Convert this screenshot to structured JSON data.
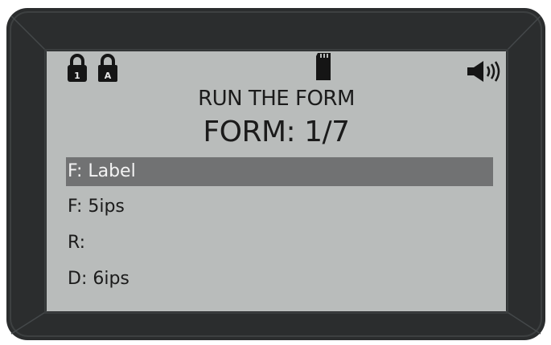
{
  "screen": {
    "title": "RUN THE FORM",
    "subtitle": "FORM: 1/7",
    "icons": {
      "lock_numeric": "lock-icon",
      "lock_numeric_badge": "1",
      "lock_alpha": "lock-icon",
      "lock_alpha_badge": "A",
      "storage": "sd-card-icon",
      "sound": "speaker-icon"
    },
    "items": [
      {
        "label": "F: Label",
        "selected": true
      },
      {
        "label": "F: 5ips",
        "selected": false
      },
      {
        "label": "R:",
        "selected": false
      },
      {
        "label": "D: 6ips",
        "selected": false
      }
    ]
  },
  "colors": {
    "bezel": "#2b2d2e",
    "screen": "#b9bcbb",
    "selection": "#717273",
    "text": "#1b1b1b"
  }
}
